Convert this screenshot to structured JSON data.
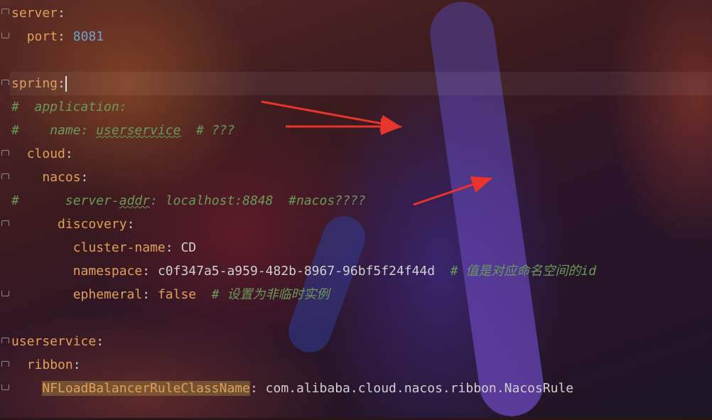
{
  "editor": {
    "language": "yaml",
    "lines": [
      {
        "key": "server",
        "sep": ":"
      },
      {
        "key": "port",
        "sep": ": ",
        "value": "8081"
      },
      {
        "key": "spring",
        "sep": ":"
      },
      {
        "comment": "#  application:"
      },
      {
        "comment_hash": "#",
        "comment_body": "    name: ",
        "comment_squig": "userservice",
        "comment_tail": "  # ???"
      },
      {
        "key": "cloud",
        "sep": ":"
      },
      {
        "key": "nacos",
        "sep": ":"
      },
      {
        "comment_hash": "#",
        "comment_body": "      server-",
        "comment_squig": "addr",
        "comment_tail": ": localhost:8848  #nacos????"
      },
      {
        "key": "discovery",
        "sep": ":"
      },
      {
        "key": "cluster-name",
        "sep": ": ",
        "value": "CD"
      },
      {
        "key": "namespace",
        "sep": ": ",
        "value": "c0f347a5-a959-482b-8967-96bf5f24f44d",
        "comment": "  # 值是对应命名空间的id"
      },
      {
        "key": "ephemeral",
        "sep": ": ",
        "value": "false",
        "comment": "  # 设置为非临时实例"
      },
      {
        "key": "userservice",
        "sep": ":"
      },
      {
        "key": "ribbon",
        "sep": ":"
      },
      {
        "key": "NFLoadBalancerRuleClassName",
        "sep": ": ",
        "value": "com.alibaba.cloud.nacos.ribbon.NacosRule"
      }
    ]
  },
  "colors": {
    "key": "#e0a05a",
    "number": "#6ea4d0",
    "comment": "#6a9a5a",
    "arrow": "#e8342c"
  },
  "icons": [
    "fold-open-icon",
    "fold-close-icon"
  ]
}
